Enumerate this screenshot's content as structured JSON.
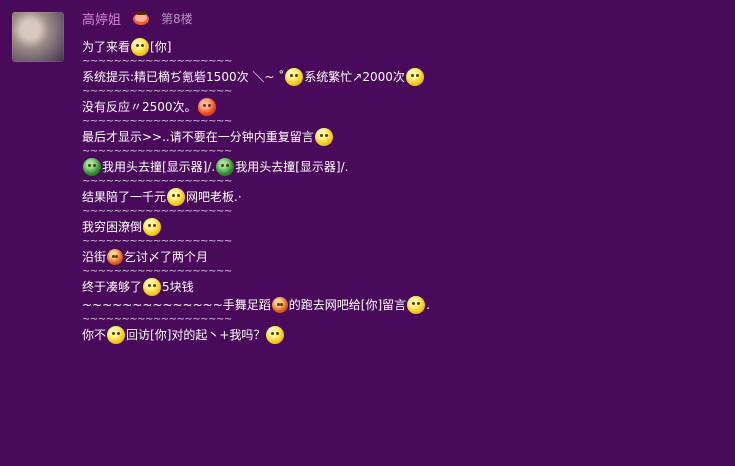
{
  "post": {
    "author": "高婷姐",
    "floor": "第8楼"
  },
  "lines": [
    {
      "t1": "为了来看",
      "t2": "[你]"
    },
    {
      "sep": "~~~~~~~~~~~~~~~~~~~"
    },
    {
      "t1": "系统提示:精已樀ぢ氪砦1500次 ＼~ ˚",
      "t2": "系统繁忙↗2000次"
    },
    {
      "sep": "~~~~~~~~~~~~~~~~~~~"
    },
    {
      "t1": "没有反应〃2500次。"
    },
    {
      "sep": "~~~~~~~~~~~~~~~~~~~"
    },
    {
      "t1": "最后才显示>>..请不要在一分钟内重复留言"
    },
    {
      "sep": "~~~~~~~~~~~~~~~~~~~"
    },
    {
      "t1": "我用头去撞[显示器]/.",
      "t2": "我用头去撞[显示器]/."
    },
    {
      "sep": "~~~~~~~~~~~~~~~~~~~"
    },
    {
      "t1": "结果陪了一千元",
      "t2": "网吧老板.·"
    },
    {
      "sep": "~~~~~~~~~~~~~~~~~~~"
    },
    {
      "t1": "我穷困潦倒"
    },
    {
      "sep": "~~~~~~~~~~~~~~~~~~~"
    },
    {
      "t1": "沿街",
      "t2": "乞讨〆了两个月"
    },
    {
      "sep": "~~~~~~~~~~~~~~~~~~~"
    },
    {
      "t1": "终于凑够了",
      "t2": "5块钱"
    },
    {
      "t1": "~~~~~~~~~~~~~~手舞足蹈",
      "t2": "的跑去网吧给[你]留言",
      "t3": "."
    },
    {
      "sep": "~~~~~~~~~~~~~~~~~~~"
    },
    {
      "t1": "你不",
      "t2": "回访[你]对的起丶+我吗？"
    }
  ]
}
